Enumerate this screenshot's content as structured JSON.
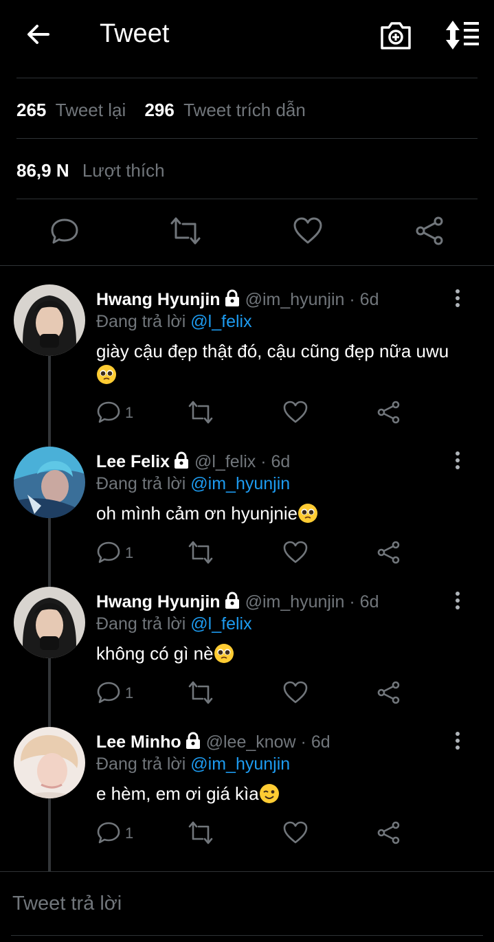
{
  "header": {
    "title": "Tweet",
    "back_icon": "arrow-left-icon",
    "camera_icon": "camera-plus-icon",
    "sort_icon": "sort-icon"
  },
  "stats": {
    "retweets": "265",
    "retweets_label": "Tweet lại",
    "quotes": "296",
    "quotes_label": "Tweet trích dẫn",
    "likes": "86,9 N",
    "likes_label": "Lượt thích"
  },
  "colors": {
    "background": "#000000",
    "mention": "#1d9bf0",
    "muted": "#71767b",
    "divider": "#2f3336"
  },
  "replies": [
    {
      "name": "Hwang Hyunjin",
      "handle": "@im_hyunjin · 6d",
      "replying_label": "Đang trả lời",
      "mention": "@l_felix",
      "text": "giày cậu đẹp thật đó, cậu cũng đẹp nữa uwu",
      "emoji": "pleading-face-emoji",
      "reply_count": "1"
    },
    {
      "name": "Lee Felix",
      "handle": "@l_felix · 6d",
      "replying_label": "Đang trả lời",
      "mention": "@im_hyunjin",
      "text": "oh mình cảm ơn hyunjnie",
      "emoji": "pleading-face-emoji",
      "reply_count": "1"
    },
    {
      "name": "Hwang Hyunjin",
      "handle": "@im_hyunjin · 6d",
      "replying_label": "Đang trả lời",
      "mention": "@l_felix",
      "text": "không có gì nè",
      "emoji": "pleading-face-emoji",
      "reply_count": "1"
    },
    {
      "name": "Lee Minho",
      "handle": "@lee_know · 6d",
      "replying_label": "Đang trả lời",
      "mention": "@im_hyunjin",
      "text": "e hèm, em ơi giá kìa",
      "emoji": "winking-face-emoji",
      "reply_count": "1"
    }
  ],
  "compose": {
    "placeholder": "Tweet trả lời"
  }
}
